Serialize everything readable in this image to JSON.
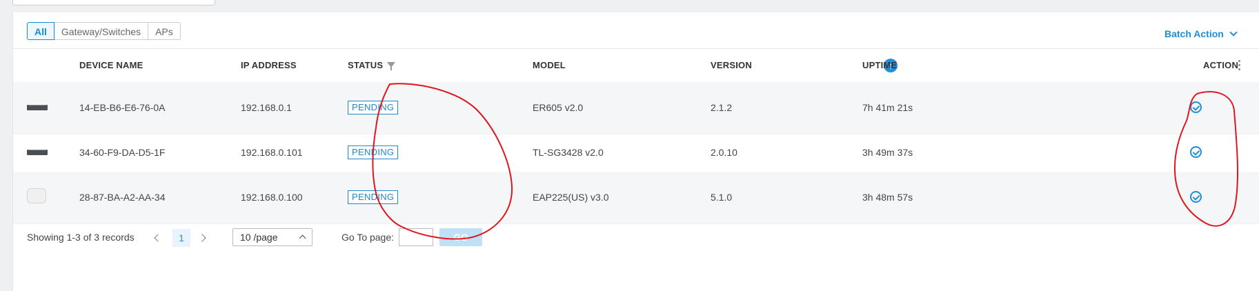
{
  "filter_tabs": [
    {
      "label": "All",
      "active": true
    },
    {
      "label": "Gateway/Switches",
      "active": false
    },
    {
      "label": "APs",
      "active": false
    }
  ],
  "batch_action_label": "Batch Action",
  "table": {
    "headers": {
      "device_name": "DEVICE NAME",
      "ip_address": "IP ADDRESS",
      "status": "STATUS",
      "model": "MODEL",
      "version": "VERSION",
      "uptime": "UPTIME",
      "action": "ACTION"
    },
    "rows": [
      {
        "icon": "switch-device-icon",
        "device_name": "14-EB-B6-E6-76-0A",
        "ip": "192.168.0.1",
        "status": "PENDING",
        "model": "ER605 v2.0",
        "version": "2.1.2",
        "uptime": "7h 41m 21s"
      },
      {
        "icon": "switch-device-icon",
        "device_name": "34-60-F9-DA-D5-1F",
        "ip": "192.168.0.101",
        "status": "PENDING",
        "model": "TL-SG3428 v2.0",
        "version": "2.0.10",
        "uptime": "3h 49m 37s"
      },
      {
        "icon": "access-point-device-icon",
        "device_name": "28-87-BA-A2-AA-34",
        "ip": "192.168.0.100",
        "status": "PENDING",
        "model": "EAP225(US) v3.0",
        "version": "5.1.0",
        "uptime": "3h 48m 57s"
      }
    ]
  },
  "pagination": {
    "showing_text": "Showing 1-3 of 3 records",
    "current_page": "1",
    "per_page": "10 /page",
    "goto_label": "Go To page:",
    "go_label": "GO"
  },
  "colors": {
    "accent": "#1e8fd6",
    "annotation": "#e0141c"
  }
}
